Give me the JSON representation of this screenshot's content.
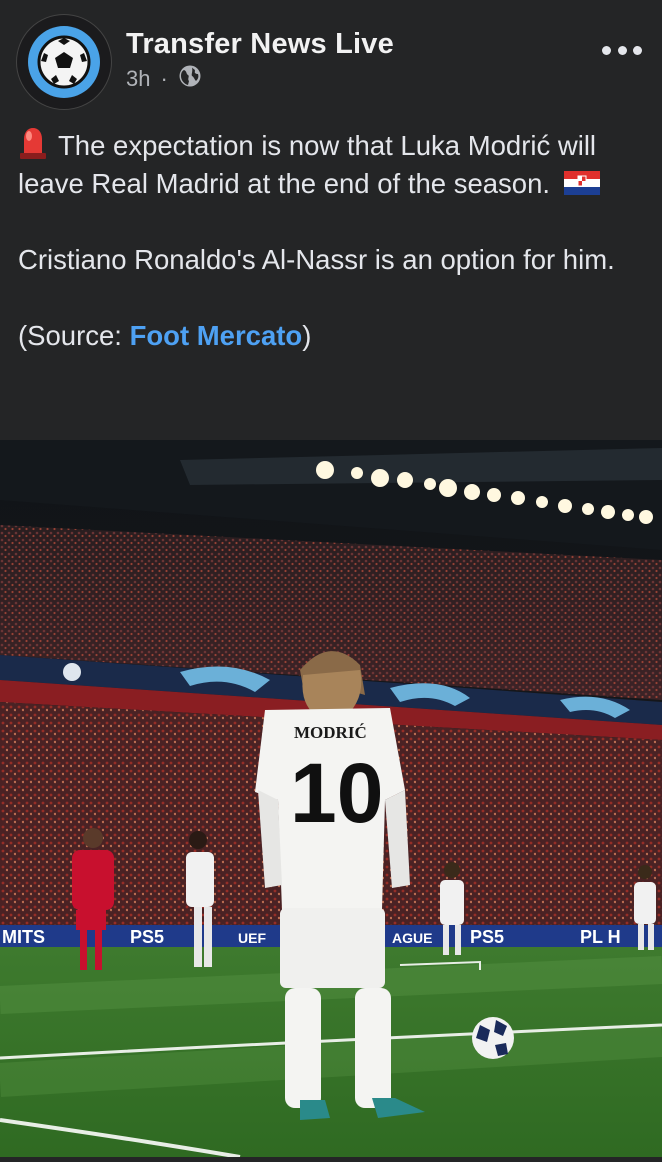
{
  "post": {
    "page_name": "Transfer News Live",
    "time": "3h",
    "separator": "·",
    "audience_icon": "globe-icon",
    "more_icon": "more-dots-icon",
    "text": {
      "line1_emoji": "siren-emoji",
      "line1": "The expectation is now that Luka Modrić will leave Real Madrid at the end of the season.",
      "flag_emoji": "croatia-flag-emoji",
      "line2": "Cristiano Ronaldo's Al-Nassr is an option for him.",
      "source_prefix": "(Source: ",
      "source_link": "Foot Mercato",
      "source_suffix": ")"
    }
  },
  "photo": {
    "shirt_name": "MODRIĆ",
    "shirt_number": "10",
    "board_text_left": "MITS",
    "board_ps5_1": "PS5",
    "board_uefa": "UEF",
    "board_league": "AGUE",
    "board_ps5_2": "PS5",
    "board_right": "PL H"
  },
  "colors": {
    "background": "#242526",
    "link": "#4ea1f3",
    "avatar_ring": "#4aa3e8"
  }
}
